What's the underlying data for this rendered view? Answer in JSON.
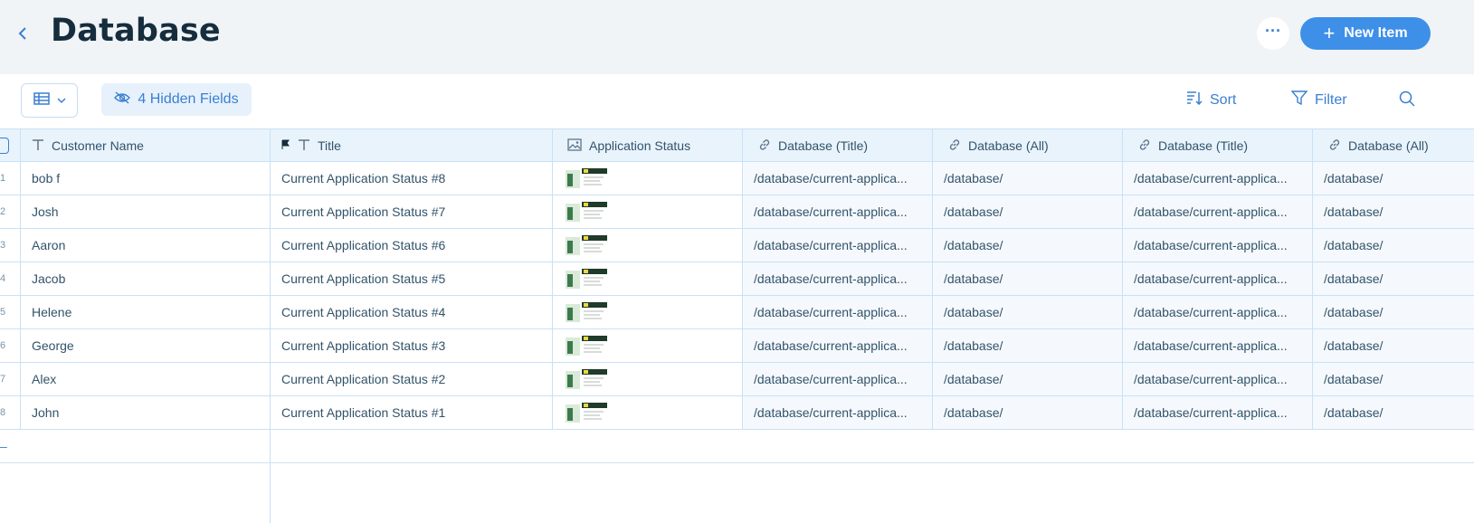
{
  "header": {
    "title": "Database",
    "more_label": "···",
    "new_item_label": "New Item"
  },
  "toolbar": {
    "hidden_fields_label": "4 Hidden Fields",
    "sort_label": "Sort",
    "filter_label": "Filter"
  },
  "columns": [
    {
      "label": "Customer Name",
      "icon": "text-icon"
    },
    {
      "label": "Title",
      "icon": "text-icon"
    },
    {
      "label": "Application Status",
      "icon": "image-icon"
    },
    {
      "label": "Database (Title)",
      "icon": "link-icon"
    },
    {
      "label": "Database (All)",
      "icon": "link-icon"
    },
    {
      "label": "Database (Title)",
      "icon": "link-icon"
    },
    {
      "label": "Database (All)",
      "icon": "link-icon"
    }
  ],
  "rows": [
    {
      "idx": "1",
      "name": "bob f",
      "title": "Current Application Status #8",
      "db_title": "/database/current-applica...",
      "db_all": "/database/"
    },
    {
      "idx": "2",
      "name": "Josh",
      "title": "Current Application Status #7",
      "db_title": "/database/current-applica...",
      "db_all": "/database/"
    },
    {
      "idx": "3",
      "name": "Aaron",
      "title": "Current Application Status #6",
      "db_title": "/database/current-applica...",
      "db_all": "/database/"
    },
    {
      "idx": "4",
      "name": "Jacob",
      "title": "Current Application Status #5",
      "db_title": "/database/current-applica...",
      "db_all": "/database/"
    },
    {
      "idx": "5",
      "name": "Helene",
      "title": "Current Application Status #4",
      "db_title": "/database/current-applica...",
      "db_all": "/database/"
    },
    {
      "idx": "6",
      "name": "George",
      "title": "Current Application Status #3",
      "db_title": "/database/current-applica...",
      "db_all": "/database/"
    },
    {
      "idx": "7",
      "name": "Alex",
      "title": "Current Application Status #2",
      "db_title": "/database/current-applica...",
      "db_all": "/database/"
    },
    {
      "idx": "8",
      "name": "John",
      "title": "Current Application Status #1",
      "db_title": "/database/current-applica...",
      "db_all": "/database/"
    }
  ],
  "colors": {
    "accent": "#3e8fe8",
    "header_bg": "#f0f4f7",
    "grid_line": "#c9e1f6"
  }
}
